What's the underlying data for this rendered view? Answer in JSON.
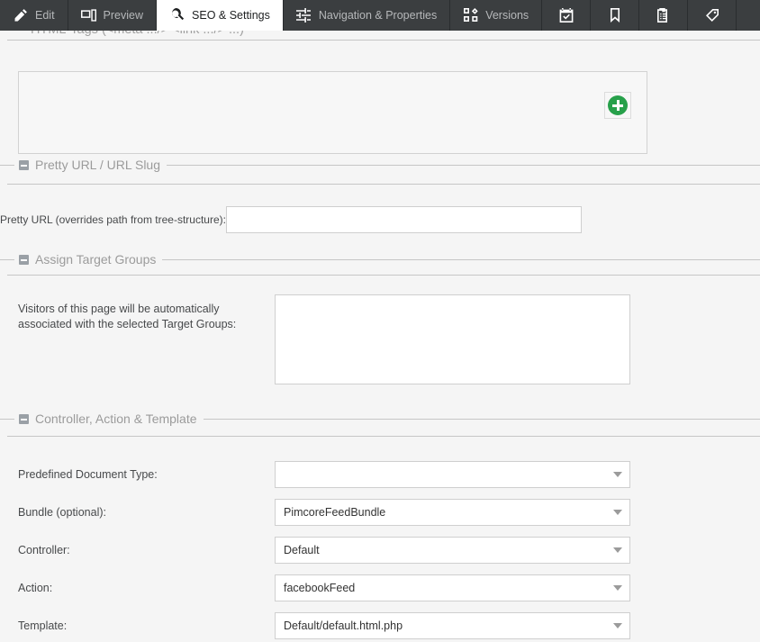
{
  "tabs": [
    {
      "label": "Edit",
      "icon": "pencil-icon",
      "active": false
    },
    {
      "label": "Preview",
      "icon": "devices-icon",
      "active": false
    },
    {
      "label": "SEO & Settings",
      "icon": "magnifier-icon",
      "active": true
    },
    {
      "label": "Navigation & Properties",
      "icon": "sliders-icon",
      "active": false
    },
    {
      "label": "Versions",
      "icon": "blocks-icon",
      "active": false
    },
    {
      "label": "",
      "icon": "calendar-check-icon",
      "active": false
    },
    {
      "label": "",
      "icon": "bookmark-icon",
      "active": false
    },
    {
      "label": "",
      "icon": "clipboard-list-icon",
      "active": false
    },
    {
      "label": "",
      "icon": "tag-icon",
      "active": false
    }
  ],
  "sections": {
    "html_tags": {
      "legend": "HTML-Tags (<meta .../> <link .../> ...)",
      "add_button_title": "Add"
    },
    "pretty_url": {
      "legend": "Pretty URL / URL Slug",
      "field_label": "Pretty URL (overrides path from tree-structure):",
      "field_value": "",
      "field_placeholder": ""
    },
    "target_groups": {
      "legend": "Assign Target Groups",
      "description_line1": "Visitors of this page will be automatically",
      "description_line2": "associated with the selected Target Groups:",
      "selected": []
    },
    "controller": {
      "legend": "Controller, Action & Template",
      "fields": [
        {
          "label": "Predefined Document Type:",
          "value": ""
        },
        {
          "label": "Bundle (optional):",
          "value": "PimcoreFeedBundle"
        },
        {
          "label": "Controller:",
          "value": "Default"
        },
        {
          "label": "Action:",
          "value": "facebookFeed"
        },
        {
          "label": "Template:",
          "value": "Default/default.html.php"
        }
      ]
    }
  },
  "colors": {
    "tabbar_bg": "#3b3e40",
    "tab_text": "#b6b8ba",
    "active_tab_bg": "#ffffff",
    "page_bg": "#f5f5f5",
    "legend_text": "#9b9b9b",
    "add_button_green": "#27a04a",
    "field_border": "#cfcfcf"
  }
}
